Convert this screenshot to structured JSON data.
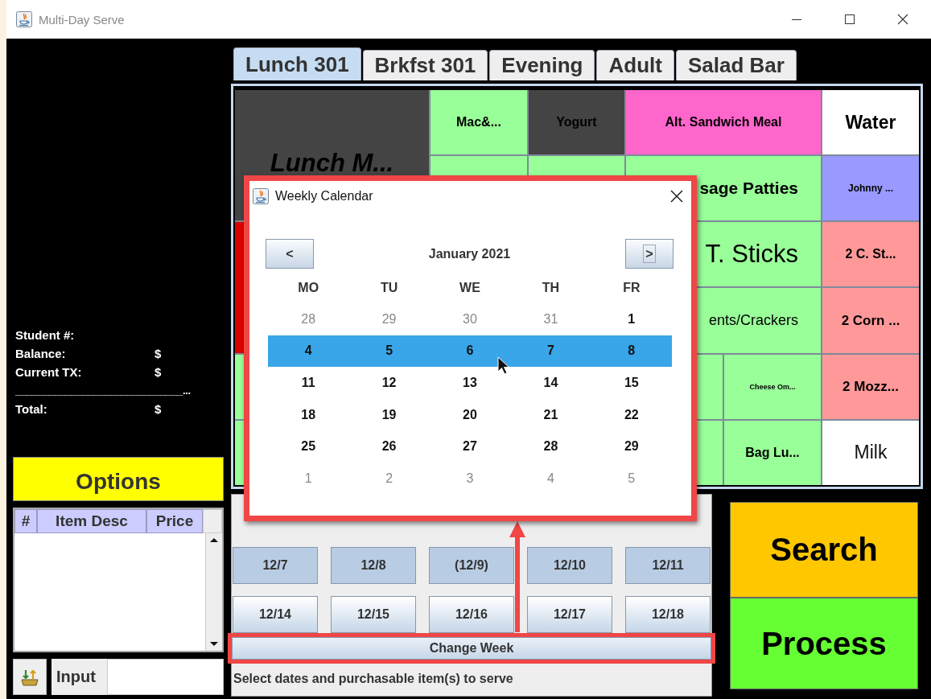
{
  "window": {
    "title": "Multi-Day Serve"
  },
  "student_info": [
    {
      "label": "Student #:"
    },
    {
      "label": "Balance:",
      "value": "$"
    },
    {
      "label": "Current TX:",
      "value": "$"
    }
  ],
  "separator": "______________________________...",
  "total": {
    "label": "Total:",
    "value": "$"
  },
  "options_button": "Options",
  "items_table": {
    "columns": [
      "#",
      "Item Desc",
      "Price"
    ]
  },
  "input": {
    "label": "Input"
  },
  "tabs": [
    {
      "label": "Lunch 301",
      "selected": true
    },
    {
      "label": "Brkfst 301",
      "selected": false
    },
    {
      "label": "Evening",
      "selected": false
    },
    {
      "label": "Adult",
      "selected": false
    },
    {
      "label": "Salad Bar",
      "selected": false
    }
  ],
  "menu_cells": [
    {
      "label": "Lunch M...",
      "color": "#444444"
    },
    {
      "label": "Mac&...",
      "color": "#99ff99"
    },
    {
      "label": "Yogurt",
      "color": "#444444"
    },
    {
      "label": "Alt. Sandwich Meal",
      "color": "#ff66cc"
    },
    {
      "label": "Water",
      "color": "#ffffff"
    },
    {
      "color": "#99ff99"
    },
    {
      "color": "#99ff99"
    },
    {
      "label": "sage Patties",
      "color": "#99ff99"
    },
    {
      "label": "Johnny ...",
      "color": "#9999ff"
    },
    {
      "color": "#dd0000"
    },
    {
      "label": "T. Sticks",
      "color": "#99ff99"
    },
    {
      "label": "2 C. St...",
      "color": "#ff9999"
    },
    {
      "label": "ents/Crackers",
      "color": "#99ff99"
    },
    {
      "label": "2 Corn ...",
      "color": "#ff9999"
    },
    {
      "color": "#99ff99"
    },
    {
      "color": "#99ff99"
    },
    {
      "label": "Cheese Om...",
      "color": "#99ff99"
    },
    {
      "label": "2 Mozz...",
      "color": "#ff9999"
    },
    {
      "color": "#99ff99"
    },
    {
      "color": "#99ff99"
    },
    {
      "label": "Bag Lu...",
      "color": "#99ff99"
    },
    {
      "label": "Milk",
      "color": "#ffffff"
    }
  ],
  "date_rows": [
    {
      "dates": [
        {
          "label": "12/7",
          "selected": true
        },
        {
          "label": "12/8",
          "selected": true
        },
        {
          "label": "(12/9)",
          "selected": true
        },
        {
          "label": "12/10",
          "selected": true
        },
        {
          "label": "12/11",
          "selected": true
        }
      ]
    },
    {
      "dates": [
        {
          "label": "12/14",
          "selected": false
        },
        {
          "label": "12/15",
          "selected": false
        },
        {
          "label": "12/16",
          "selected": false
        },
        {
          "label": "12/17",
          "selected": false
        },
        {
          "label": "12/18",
          "selected": false
        }
      ]
    }
  ],
  "change_week_button": "Change Week",
  "status_text": "Select dates and purchasable item(s) to serve",
  "search_button": "Search",
  "process_button": "Process",
  "calendar_dialog": {
    "title": "Weekly Calendar",
    "prev": {
      "label": "<",
      "focused": false
    },
    "next": {
      "label": ">",
      "focused": true
    },
    "month": "January 2021",
    "weekdays": [
      "MO",
      "TU",
      "WE",
      "TH",
      "FR"
    ],
    "weeks": [
      {
        "selected": false,
        "days": [
          {
            "label": "28",
            "muted": true
          },
          {
            "label": "29",
            "muted": true
          },
          {
            "label": "30",
            "muted": true
          },
          {
            "label": "31",
            "muted": true
          },
          {
            "label": "1",
            "muted": false
          }
        ]
      },
      {
        "selected": true,
        "days": [
          {
            "label": "4",
            "muted": false
          },
          {
            "label": "5",
            "muted": false
          },
          {
            "label": "6",
            "muted": false
          },
          {
            "label": "7",
            "muted": false
          },
          {
            "label": "8",
            "muted": false
          }
        ]
      },
      {
        "selected": false,
        "days": [
          {
            "label": "11",
            "muted": false
          },
          {
            "label": "12",
            "muted": false
          },
          {
            "label": "13",
            "muted": false
          },
          {
            "label": "14",
            "muted": false
          },
          {
            "label": "15",
            "muted": false
          }
        ]
      },
      {
        "selected": false,
        "days": [
          {
            "label": "18",
            "muted": false
          },
          {
            "label": "19",
            "muted": false
          },
          {
            "label": "20",
            "muted": false
          },
          {
            "label": "21",
            "muted": false
          },
          {
            "label": "22",
            "muted": false
          }
        ]
      },
      {
        "selected": false,
        "days": [
          {
            "label": "25",
            "muted": false
          },
          {
            "label": "26",
            "muted": false
          },
          {
            "label": "27",
            "muted": false
          },
          {
            "label": "28",
            "muted": false
          },
          {
            "label": "29",
            "muted": false
          }
        ]
      },
      {
        "selected": false,
        "days": [
          {
            "label": "1",
            "muted": true
          },
          {
            "label": "2",
            "muted": true
          },
          {
            "label": "3",
            "muted": true
          },
          {
            "label": "4",
            "muted": true
          },
          {
            "label": "5",
            "muted": true
          }
        ]
      }
    ]
  }
}
